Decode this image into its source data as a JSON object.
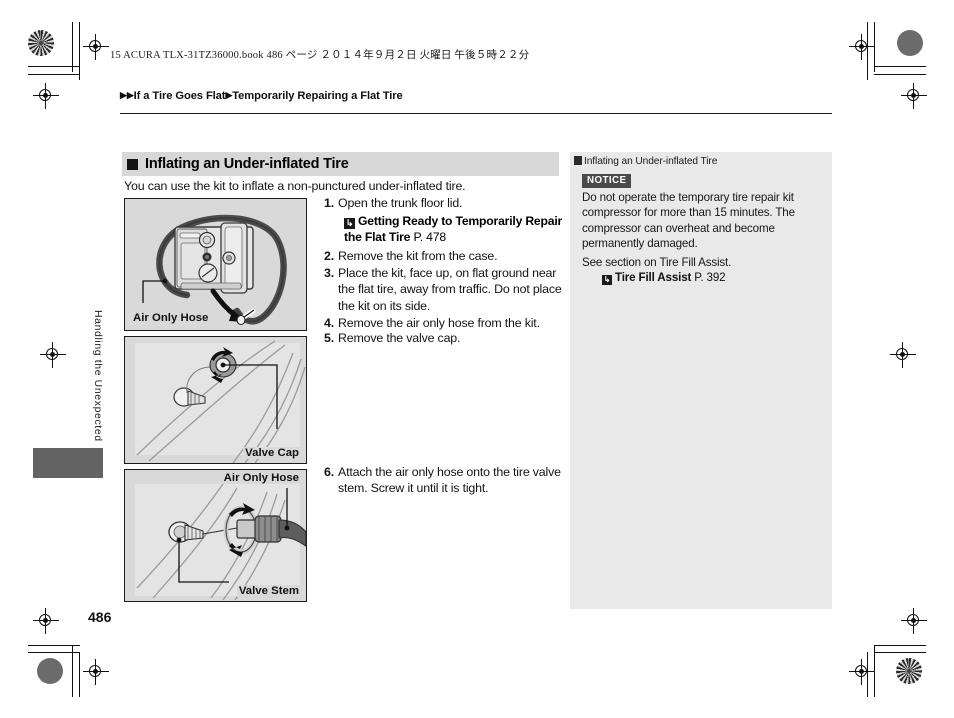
{
  "document": {
    "book_info": "15 ACURA TLX-31TZ36000.book   486 ページ   ２０１４年９月２日   火曜日   午後５時２２分",
    "page_number": "486",
    "side_tab_label": "Handling the Unexpected"
  },
  "breadcrumb": {
    "marker1": "▶",
    "marker2": "▶",
    "level1": "If a Tire Goes Flat",
    "sep": "▶",
    "level2": "Temporarily Repairing a Flat Tire"
  },
  "section": {
    "heading": "Inflating an Under-inflated Tire",
    "intro": "You can use the kit to inflate a non-punctured under-inflated tire."
  },
  "steps": [
    {
      "num": "1.",
      "text": "Open the trunk floor lid."
    },
    {
      "num": "2.",
      "text": "Remove the kit from the case."
    },
    {
      "num": "3.",
      "text": "Place the kit, face up, on flat ground near the flat tire, away from traffic. Do not place the kit on its side."
    },
    {
      "num": "4.",
      "text": "Remove the air only hose from the kit."
    },
    {
      "num": "5.",
      "text": "Remove the valve cap."
    },
    {
      "num": "6.",
      "text": "Attach the air only hose onto the tire valve stem. Screw it until it is tight."
    }
  ],
  "step_xref": {
    "icon": "↳",
    "title": "Getting Ready to Temporarily Repair the Flat Tire",
    "page": "P. 478"
  },
  "figures": [
    {
      "caption": "Air Only Hose"
    },
    {
      "caption": "Valve Cap"
    },
    {
      "caption_top": "Air Only Hose",
      "caption_bottom": "Valve Stem"
    }
  ],
  "info_panel": {
    "title": "Inflating an Under-inflated Tire",
    "notice_label": "NOTICE",
    "notice_text": "Do not operate the temporary tire repair kit compressor for more than 15 minutes. The compressor can overheat and become permanently damaged.",
    "see_section": "See section on Tire Fill Assist.",
    "xref_icon": "↳",
    "xref_title": "Tire Fill Assist",
    "xref_page": "P. 392"
  },
  "colors": {
    "heading_band": "#d7d7d7",
    "info_panel_bg": "#e9e9e9",
    "figure_bg": "#d9d9d9",
    "tab_block": "#636363",
    "notice_badge": "#4a4a4a"
  }
}
